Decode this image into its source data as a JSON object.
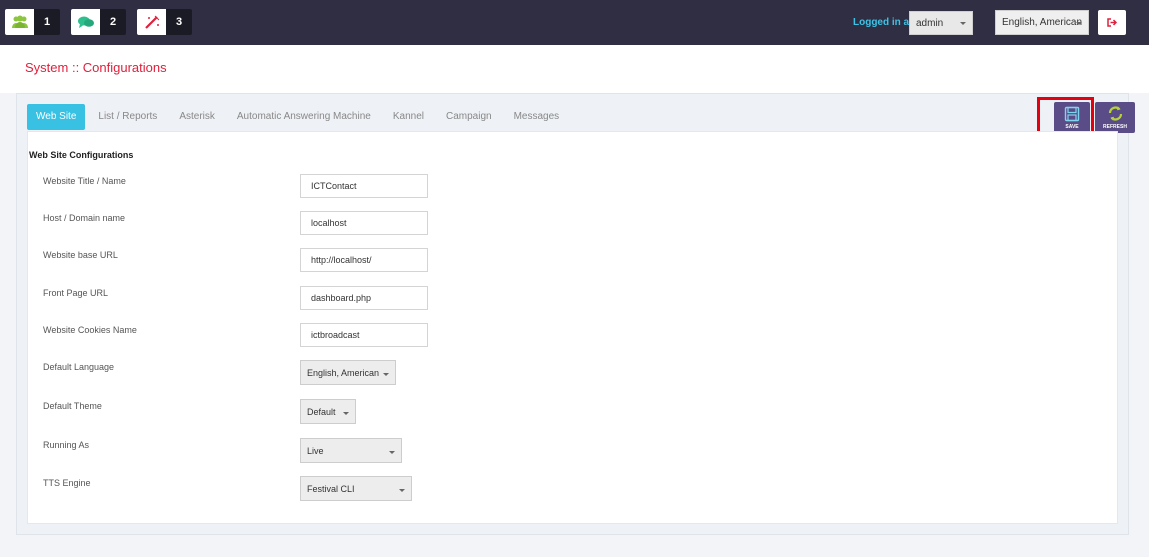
{
  "header": {
    "badges": [
      {
        "icon": "users-icon",
        "count": "1"
      },
      {
        "icon": "chat-icon",
        "count": "2"
      },
      {
        "icon": "magic-wand-icon",
        "count": "3"
      }
    ],
    "logged_in_label": "Logged in as :",
    "user": "admin",
    "language": "English, American",
    "logout_icon": "logout-icon"
  },
  "page": {
    "title": "System :: Configurations"
  },
  "tabs": [
    {
      "label": "Web Site",
      "active": true
    },
    {
      "label": "List / Reports",
      "active": false
    },
    {
      "label": "Asterisk",
      "active": false
    },
    {
      "label": "Automatic Answering Machine",
      "active": false
    },
    {
      "label": "Kannel",
      "active": false
    },
    {
      "label": "Campaign",
      "active": false
    },
    {
      "label": "Messages",
      "active": false
    }
  ],
  "actions": {
    "save_label": "SAVE",
    "refresh_label": "REFRESH",
    "save_icon": "floppy-disk-icon",
    "refresh_icon": "refresh-icon"
  },
  "form": {
    "section_title": "Web Site Configurations",
    "rows": [
      {
        "label": "Website Title / Name",
        "value": "ICTContact"
      },
      {
        "label": "Host / Domain name",
        "value": "localhost"
      },
      {
        "label": "Website base URL",
        "value": "http://localhost/"
      },
      {
        "label": "Front Page URL",
        "value": "dashboard.php"
      },
      {
        "label": "Website Cookies Name",
        "value": "ictbroadcast"
      },
      {
        "label": "Default Language",
        "value": "English, American"
      },
      {
        "label": "Default Theme",
        "value": "Default"
      },
      {
        "label": "Running As",
        "value": "Live"
      },
      {
        "label": "TTS Engine",
        "value": "Festival CLI"
      }
    ]
  },
  "colors": {
    "topbar": "#2f2e43",
    "title": "#e0203c",
    "tab_active": "#39c1e3",
    "action_button": "#5a4d87",
    "highlight": "#e3000f"
  }
}
